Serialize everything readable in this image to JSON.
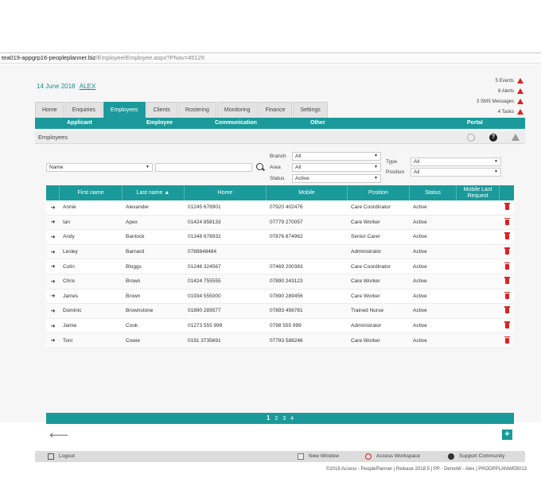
{
  "browser": {
    "url_host": "tea019-appgrp16-peopleplanner.biz",
    "url_path": "/Employee/Employee.aspx?PNav=45129"
  },
  "header": {
    "date": "14 June 2018",
    "user": "ALEX"
  },
  "alerts": [
    {
      "text": "5 Events"
    },
    {
      "text": "8 Alerts"
    },
    {
      "text": "3 SMS Messages"
    },
    {
      "text": "4 Tasks"
    }
  ],
  "tabs": [
    {
      "label": "Home"
    },
    {
      "label": "Enquiries"
    },
    {
      "label": "Employees",
      "active": true
    },
    {
      "label": "Clients"
    },
    {
      "label": "Rostering"
    },
    {
      "label": "Monitoring"
    },
    {
      "label": "Finance"
    },
    {
      "label": "Settings"
    }
  ],
  "subnav": [
    {
      "label": "Applicant"
    },
    {
      "label": "Employee"
    },
    {
      "label": "Communication"
    },
    {
      "label": "Other"
    },
    {
      "label": "Portal"
    }
  ],
  "section": {
    "title": "Employees"
  },
  "filters": {
    "name_select": "Name",
    "branch_label": "Branch",
    "branch_value": "All",
    "area_label": "Area",
    "area_value": "All",
    "status_label": "Status",
    "status_value": "Active",
    "type_label": "Type",
    "type_value": "All",
    "position_label": "Position",
    "position_value": "All"
  },
  "table": {
    "columns": [
      "First name",
      "Last name ▲",
      "Home",
      "Mobile",
      "Position",
      "Status",
      "Mobile Last Request"
    ],
    "rows": [
      [
        "Annie",
        "Alexander",
        "01245 678901",
        "07920 402476",
        "Care Coordinator",
        "Active"
      ],
      [
        "Ian",
        "Apex",
        "01424 858133",
        "07779 270057",
        "Care Worker",
        "Active"
      ],
      [
        "Andy",
        "Bantock",
        "01348 678932",
        "07876 874962",
        "Senior Carer",
        "Active"
      ],
      [
        "Lesley",
        "Barnard",
        "0788848484",
        "",
        "Administrator",
        "Active"
      ],
      [
        "Colin",
        "Bloggs",
        "01246 324567",
        "07469 200383",
        "Care Coordinator",
        "Active"
      ],
      [
        "Chris",
        "Brown",
        "01424 755555",
        "07890 243123",
        "Care Worker",
        "Active"
      ],
      [
        "James",
        "Brown",
        "01934 555000",
        "07890 289456",
        "Care Worker",
        "Active"
      ],
      [
        "Dominic",
        "Brownstone",
        "01890 289577",
        "07893 456781",
        "Trained Nurse",
        "Active"
      ],
      [
        "Jamie",
        "Cook",
        "01273 555 999",
        "0798 555 999",
        "Administrator",
        "Active"
      ],
      [
        "Toni",
        "Cowie",
        "0191 3735691",
        "07793 588246",
        "Care Worker",
        "Active"
      ]
    ]
  },
  "pager": {
    "current": "1",
    "pages": [
      "2",
      "3",
      "4"
    ]
  },
  "footer": {
    "logout": "Logout",
    "new_window": "New Window",
    "access_workspace": "Access Workspace",
    "support_community": "Support Community"
  },
  "copyright": "©2018 Access - PeoplePlanner | Release 2018.5 | PP - DemoW - Alex | PRODPPLANWEB013",
  "colors": {
    "accent": "#1a9a9a",
    "alert": "#dd2222"
  }
}
